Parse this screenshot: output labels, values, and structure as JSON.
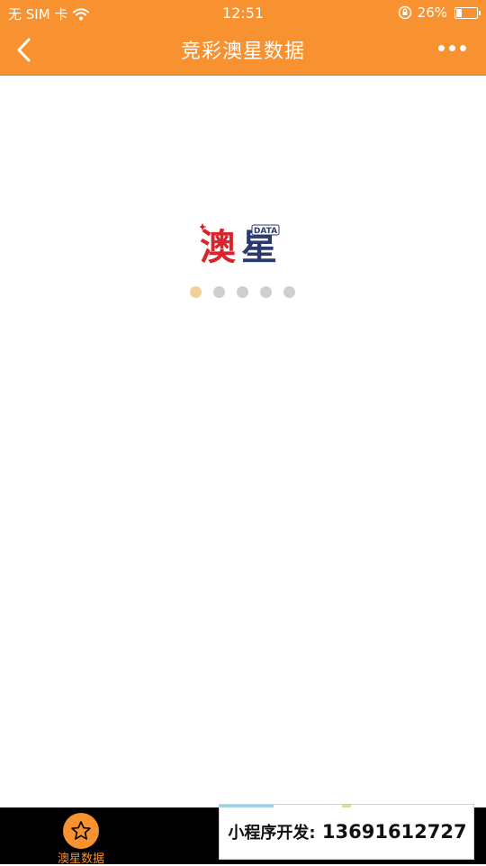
{
  "status_bar": {
    "carrier": "无 SIM 卡",
    "time": "12:51",
    "battery_percent": "26%",
    "battery_level": 0.26
  },
  "nav": {
    "title": "竞彩澳星数据"
  },
  "logo": {
    "text_main": "澳星",
    "text_badge": "DATA"
  },
  "loader": {
    "dot_count": 5,
    "active_index": 0
  },
  "tabbar": {
    "tabs": [
      {
        "label": "澳星数据",
        "icon": "star-icon",
        "active": true
      },
      {
        "label": "",
        "icon": "",
        "active": false
      },
      {
        "label": "",
        "icon": "",
        "active": false
      }
    ],
    "active_color": "#f8912f"
  },
  "promo": {
    "label": "小程序开发:",
    "phone": "13691612727"
  },
  "colors": {
    "header_bg": "#f8912f",
    "active_dot": "#f3cf9b",
    "inactive_dot": "#cfcfcf"
  }
}
